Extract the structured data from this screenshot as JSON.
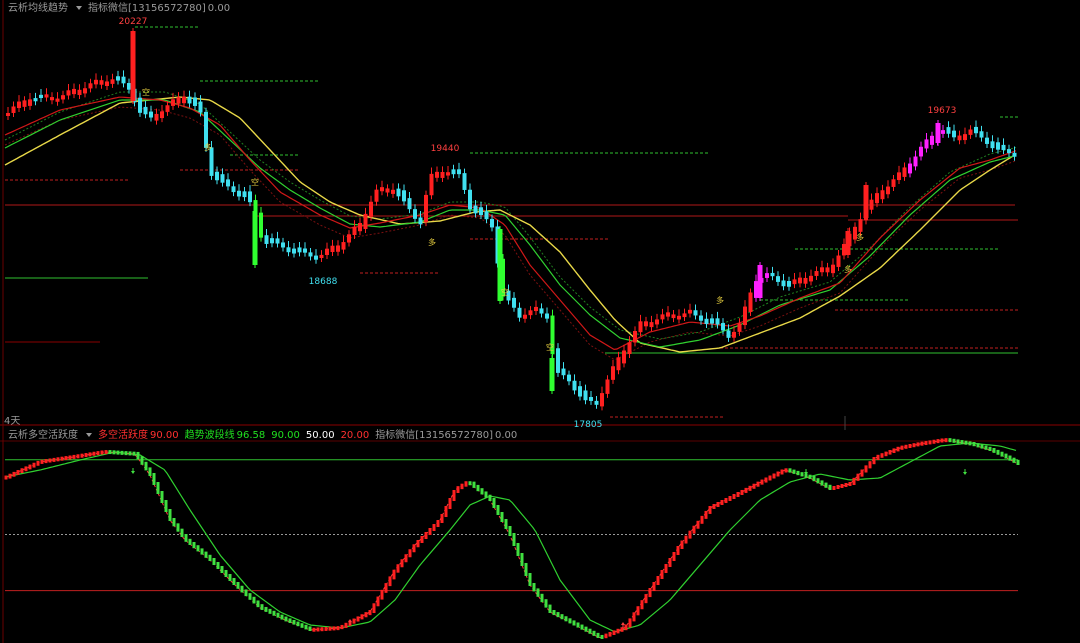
{
  "top_panel": {
    "indicator_name": "云析均线趋势",
    "wechat_label": "指标微信[13156572780]",
    "wechat_value": "0.00"
  },
  "divider": {
    "label": "4天"
  },
  "bottom_panel": {
    "indicator_name": "云析多空活跃度",
    "long_short_label": "多空活跃度",
    "long_short_value": "90.00",
    "trend_label": "趋势波段线",
    "trend_value": "96.58",
    "level_high": "90.00",
    "level_mid": "50.00",
    "level_low": "20.00",
    "wechat_label": "指标微信[13156572780]",
    "wechat_value": "0.00"
  },
  "colors": {
    "up": "#ff2020",
    "down": "#40e0f0",
    "strong_down": "#30ff30",
    "strong_up": "#ff20ff",
    "ma_yellow": "#e8d848",
    "ma_green": "#30d030",
    "ma_red": "#d01818",
    "annotation_yellow": "#e8d040"
  },
  "chart_data": [
    {
      "type": "candlestick",
      "peak_labels": [
        {
          "text": "20227",
          "color": "red"
        },
        {
          "text": "18688",
          "color": "cyan"
        },
        {
          "text": "19440",
          "color": "red"
        },
        {
          "text": "17805",
          "color": "cyan"
        },
        {
          "text": "19673",
          "color": "red"
        }
      ],
      "signal_marks": [
        "空",
        "多",
        "多",
        "空",
        "空",
        "空",
        "多",
        "多",
        "多"
      ]
    },
    {
      "type": "line",
      "reference_levels": [
        90,
        50,
        20
      ]
    }
  ]
}
